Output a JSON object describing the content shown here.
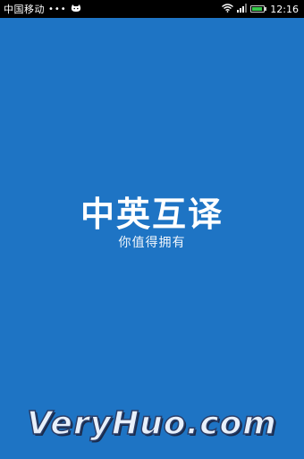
{
  "status_bar": {
    "carrier": "中国移动",
    "dots": "•••",
    "notification_icon": "cat-icon",
    "wifi_icon": "wifi-icon",
    "signal_icon": "signal-icon",
    "battery_icon": "battery-icon",
    "battery_level": 0.9,
    "time": "12:16"
  },
  "splash": {
    "title": "中英互译",
    "slogan": "你值得拥有",
    "background_color": "#1e74c4"
  },
  "watermark": {
    "text": "VeryHuo.com"
  }
}
